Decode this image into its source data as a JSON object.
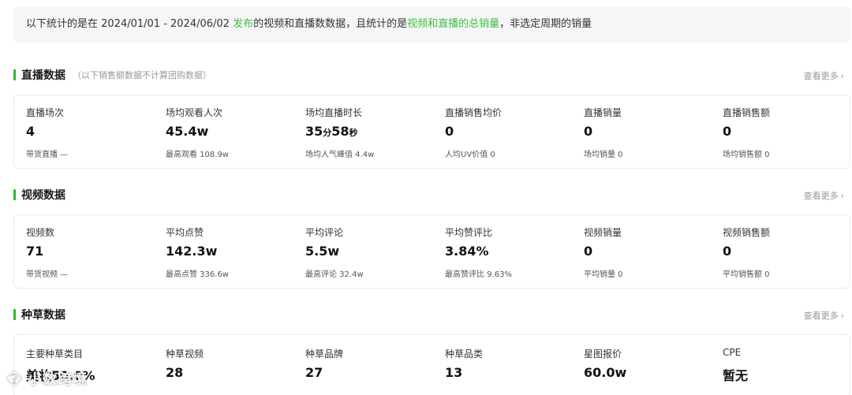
{
  "notice": {
    "part1": "以下统计的是在 2024/01/01 - 2024/06/02 ",
    "highlight1": "发布",
    "part2": "的视频和直播数数据，且统计的是",
    "highlight2": "视频和直播的总销量",
    "part3": "，非选定周期的销量"
  },
  "colors": {
    "accent": "#2fb82f",
    "highlight": "#3fbf3f"
  },
  "sections": [
    {
      "title": "直播数据",
      "subtitle": "（以下销售额数据不计算团购数据）",
      "more": "查看更多",
      "metrics": [
        {
          "label": "直播场次",
          "value": "4",
          "sub": "带货直播 —"
        },
        {
          "label": "场均观看人次",
          "value": "45.4w",
          "sub": "最高观看 108.9w"
        },
        {
          "label": "场均直播时长",
          "value_a": "35",
          "unit_a": "分",
          "value_b": "58",
          "unit_b": "秒",
          "sub": "场均人气峰值 4.4w"
        },
        {
          "label": "直播销售均价",
          "value": "0",
          "sub": "人均UV价值 0"
        },
        {
          "label": "直播销量",
          "value": "0",
          "sub": "场均销量 0"
        },
        {
          "label": "直播销售额",
          "value": "0",
          "sub": "场均销售额 0"
        }
      ]
    },
    {
      "title": "视频数据",
      "more": "查看更多",
      "metrics": [
        {
          "label": "视频数",
          "value": "71",
          "sub": "带货视频 —"
        },
        {
          "label": "平均点赞",
          "value": "142.3w",
          "sub": "最高点赞 336.6w"
        },
        {
          "label": "平均评论",
          "value": "5.5w",
          "sub": "最高评论 32.4w"
        },
        {
          "label": "平均赞评比",
          "value": "3.84%",
          "sub": "最高赞评比 9.63%"
        },
        {
          "label": "视频销量",
          "value": "0",
          "sub": "平均销量 0"
        },
        {
          "label": "视频销售额",
          "value": "0",
          "sub": "平均销售额 0"
        }
      ]
    },
    {
      "title": "种草数据",
      "more": "查看更多",
      "metrics": [
        {
          "label": "主要种草类目",
          "value": "美妆50.0%"
        },
        {
          "label": "种草视频",
          "value": "28"
        },
        {
          "label": "种草品牌",
          "value": "27"
        },
        {
          "label": "种草品类",
          "value": "13"
        },
        {
          "label": "星图报价",
          "value": "60.0w"
        },
        {
          "label": "CPE",
          "value": "暂无"
        }
      ]
    }
  ],
  "watermark": {
    "icon": "brand-logo-icon",
    "glyph": "�",
    "text": "小数跨境"
  }
}
